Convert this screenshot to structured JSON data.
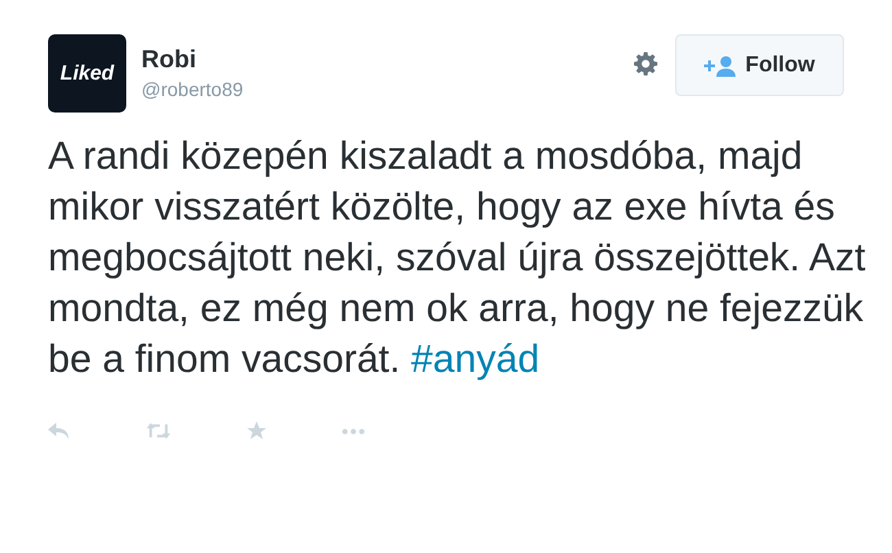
{
  "author": {
    "avatar_text": "Liked",
    "name": "Robi",
    "handle": "@roberto89"
  },
  "follow_button": {
    "label": "Follow"
  },
  "tweet": {
    "text": "A randi közepén kiszaladt a mosdóba, majd mikor visszatért közölte, hogy az exe hívta és megbocsájtott neki, szóval újra összejöttek. Azt mondta, ez még nem ok arra, hogy ne fejezzük be a finom vacsorát.",
    "hashtag": "#anyád"
  }
}
